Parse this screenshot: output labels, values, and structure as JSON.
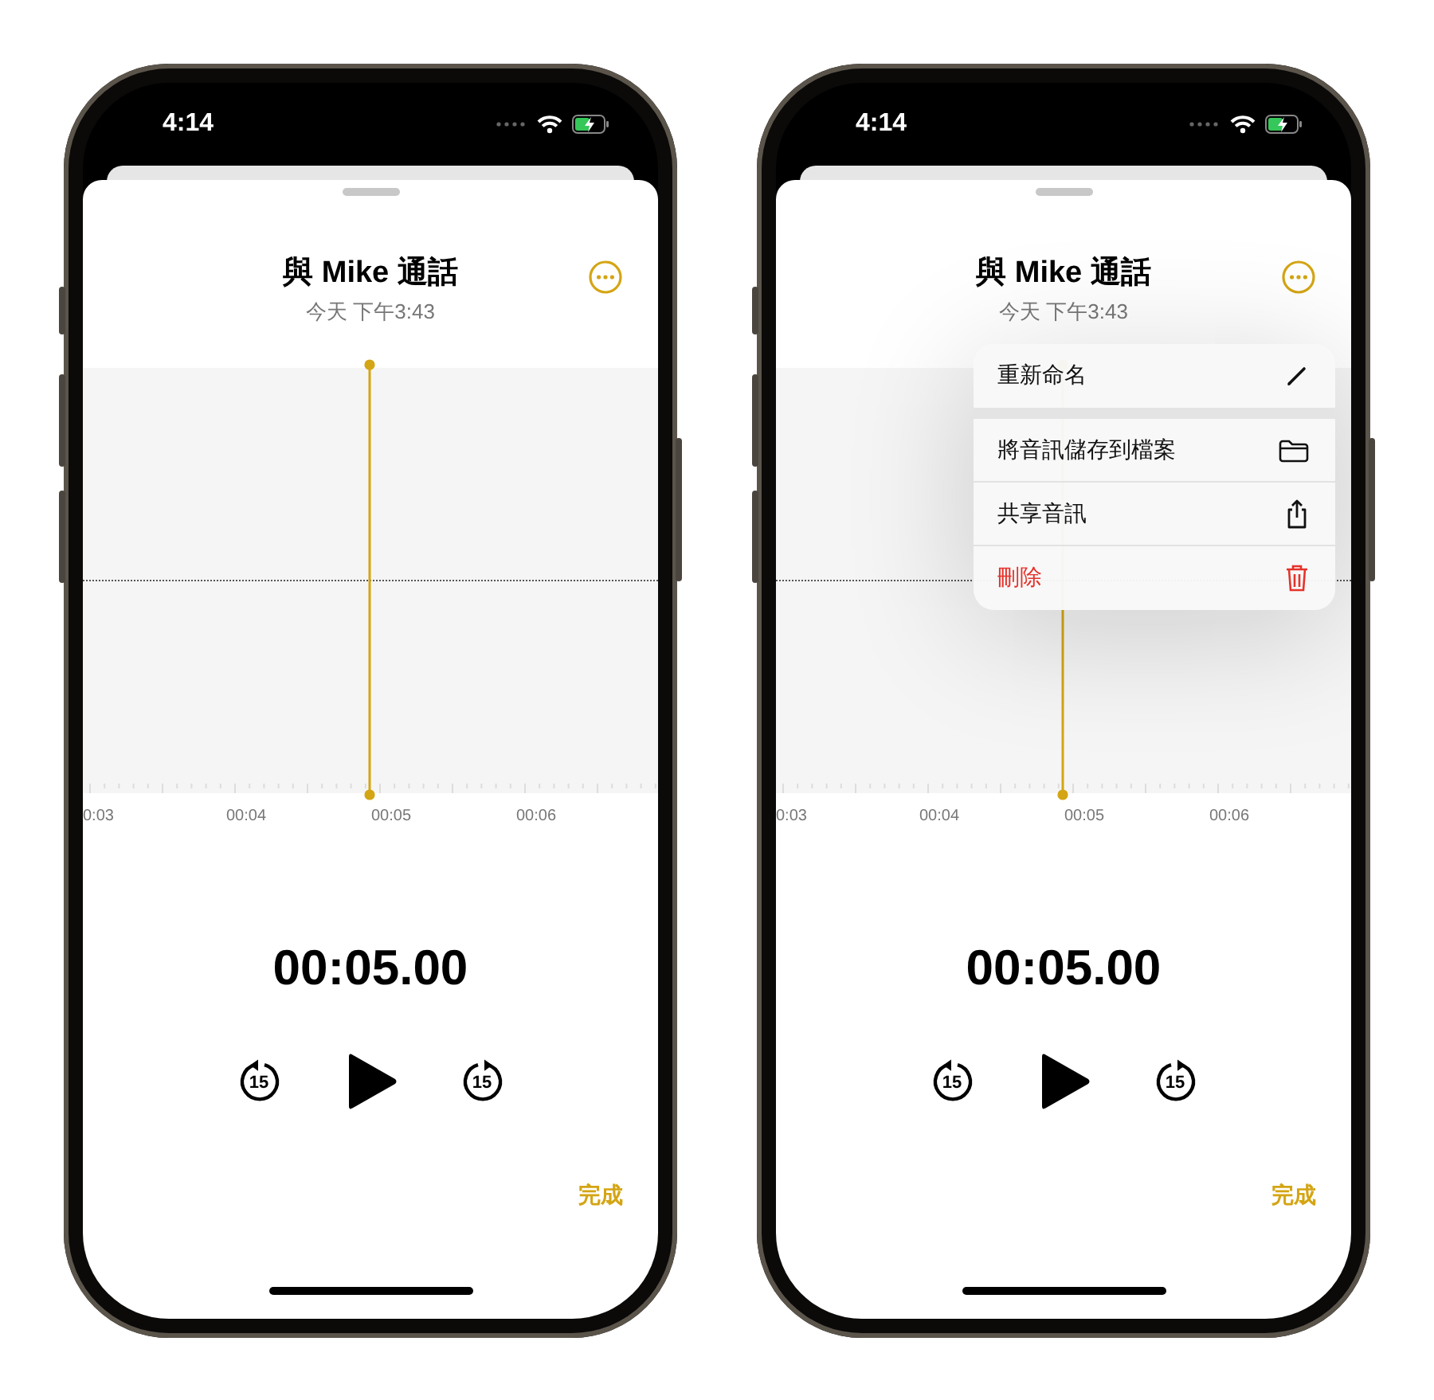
{
  "phones": [
    {
      "status_bar": {
        "time": "4:14"
      },
      "title": "與 Mike 通話",
      "subtitle": "今天 下午3:43",
      "timeline_labels": [
        "0:03",
        "00:04",
        "00:05",
        "00:06"
      ],
      "elapsed": "00:05.00",
      "skip_back": "15",
      "skip_forward": "15",
      "done": "完成"
    },
    {
      "status_bar": {
        "time": "4:14"
      },
      "title": "與 Mike 通話",
      "subtitle": "今天 下午3:43",
      "timeline_labels": [
        "0:03",
        "00:04",
        "00:05",
        "00:06"
      ],
      "elapsed": "00:05.00",
      "skip_back": "15",
      "skip_forward": "15",
      "done": "完成",
      "menu": {
        "groups": [
          [
            {
              "label": "重新命名",
              "destructive": false
            }
          ],
          [
            {
              "label": "將音訊儲存到檔案",
              "destructive": false
            },
            {
              "label": "共享音訊",
              "destructive": false
            },
            {
              "label": "刪除",
              "destructive": true
            }
          ]
        ]
      }
    }
  ]
}
